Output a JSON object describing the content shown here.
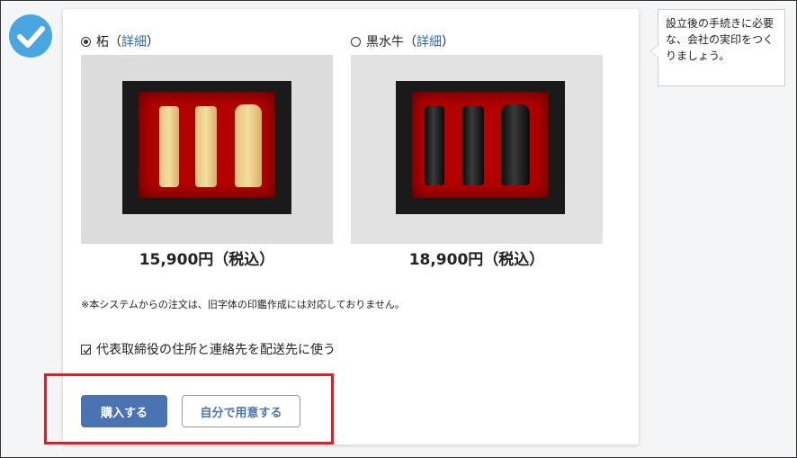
{
  "options": [
    {
      "name": "柘",
      "paren_open": "（",
      "link": "詳細",
      "paren_close": "）",
      "selected": true,
      "price": "15,900円（税込）"
    },
    {
      "name": "黒水牛",
      "paren_open": "（",
      "link": "詳細",
      "paren_close": "）",
      "selected": false,
      "price": "18,900円（税込）"
    }
  ],
  "note": "※本システムからの注文は、旧字体の印鑑作成には対応しておりません。",
  "shipping_checkbox": {
    "label": "代表取締役の住所と連絡先を配送先に使う",
    "checked": true
  },
  "buttons": {
    "buy": "購入する",
    "self_prepare": "自分で用意する"
  },
  "tooltip": "設立後の手続きに必要な、会社の実印をつくりましょう。",
  "colors": {
    "accent": "#4a73b1",
    "link": "#2a6db5",
    "highlight": "#e31b23",
    "check": "#4aa6e0"
  }
}
